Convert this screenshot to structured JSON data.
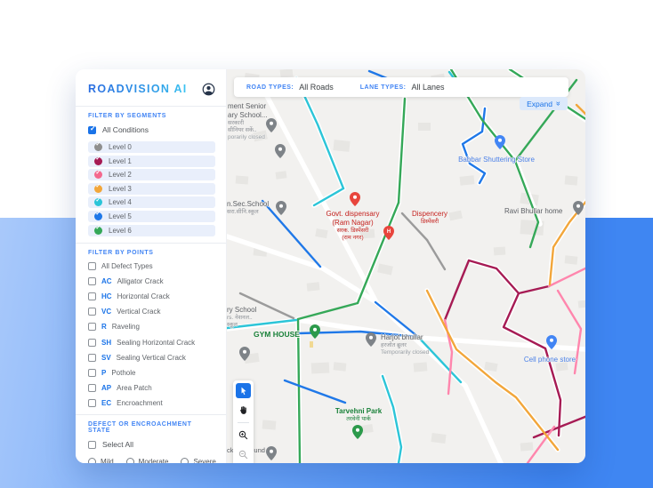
{
  "app": {
    "logo": "ROADVISION AI"
  },
  "toolbar": {
    "road_types_label": "ROAD TYPES:",
    "road_types_value": "All Roads",
    "lane_types_label": "LANE TYPES:",
    "lane_types_value": "All Lanes",
    "expand_label": "Expand",
    "expand_chevrons": "»"
  },
  "sidebar": {
    "segments": {
      "title": "FILTER BY SEGMENTS",
      "all_conditions": "All Conditions",
      "levels": [
        {
          "label": "Level 0",
          "color": "#8f8f8f"
        },
        {
          "label": "Level 1",
          "color": "#a61b54"
        },
        {
          "label": "Level 2",
          "color": "#f4688e"
        },
        {
          "label": "Level 3",
          "color": "#f2a63a"
        },
        {
          "label": "Level 4",
          "color": "#2cc5d8"
        },
        {
          "label": "Level 5",
          "color": "#1f78e8"
        },
        {
          "label": "Level 6",
          "color": "#35a858"
        }
      ]
    },
    "points": {
      "title": "FILTER BY POINTS",
      "items": [
        {
          "abbr": "",
          "label": "All Defect Types"
        },
        {
          "abbr": "AC",
          "label": "Alligator Crack"
        },
        {
          "abbr": "HC",
          "label": "Horizontal Crack"
        },
        {
          "abbr": "VC",
          "label": "Vertical Crack"
        },
        {
          "abbr": "R",
          "label": "Raveling"
        },
        {
          "abbr": "SH",
          "label": "Sealing Horizontal Crack"
        },
        {
          "abbr": "SV",
          "label": "Sealing Vertical Crack"
        },
        {
          "abbr": "P",
          "label": "Pothole"
        },
        {
          "abbr": "AP",
          "label": "Area Patch"
        },
        {
          "abbr": "EC",
          "label": "Encroachment"
        }
      ]
    },
    "state": {
      "title": "DEFECT OR ENCROACHMENT STATE",
      "select_all": "Select All",
      "options": [
        "Mild",
        "Moderate",
        "Severe"
      ]
    }
  },
  "map": {
    "labels": {
      "school_top": {
        "line1": "ment Senior",
        "line2": "ary School...",
        "line3": "सरकारी",
        "line4": "सीनियर सकें..",
        "line5": "porarily closed"
      },
      "sec_school": {
        "line1": "n.Sec.School",
        "line2": "सरा.सीनि.स्कूल"
      },
      "govt_disp": {
        "line1": "Govt. dispensary",
        "line2": "(Ram Nagar)",
        "line3": "सरक. डिस्पेंसरी",
        "line4": "(राम नगर)"
      },
      "dispencery": {
        "line1": "Dispencery",
        "line2": "डिस्पेंसरी"
      },
      "babbar": {
        "line1": "Babbar Shuttering Store"
      },
      "ravi": {
        "line1": "Ravi Bhullar home"
      },
      "gym": {
        "line1": "GYM HOUSE"
      },
      "ry_school": {
        "line1": "ry School",
        "line2": "rs. नेशनल..",
        "line3": "स्कूल"
      },
      "harjot": {
        "line1": "Harjot bhullar",
        "line2": "हरजोत ब्रुलर",
        "line3": "Temporarily closed"
      },
      "cell": {
        "line1": "Cell phone store"
      },
      "tarvehni": {
        "line1": "Tarvehni Park",
        "line2": "तरवेनी पार्क"
      },
      "ground": {
        "line1": "cken Ground"
      }
    }
  },
  "colors": {
    "accent_blue": "#1a73e8",
    "section_label_blue": "#4285f4",
    "expand_pill_bg": "#dce9fb",
    "page_bottom_blue": "#3f86f2",
    "hospital_red": "#c5221f",
    "park_green": "#188038",
    "poi_blue": "#4d82e8"
  }
}
